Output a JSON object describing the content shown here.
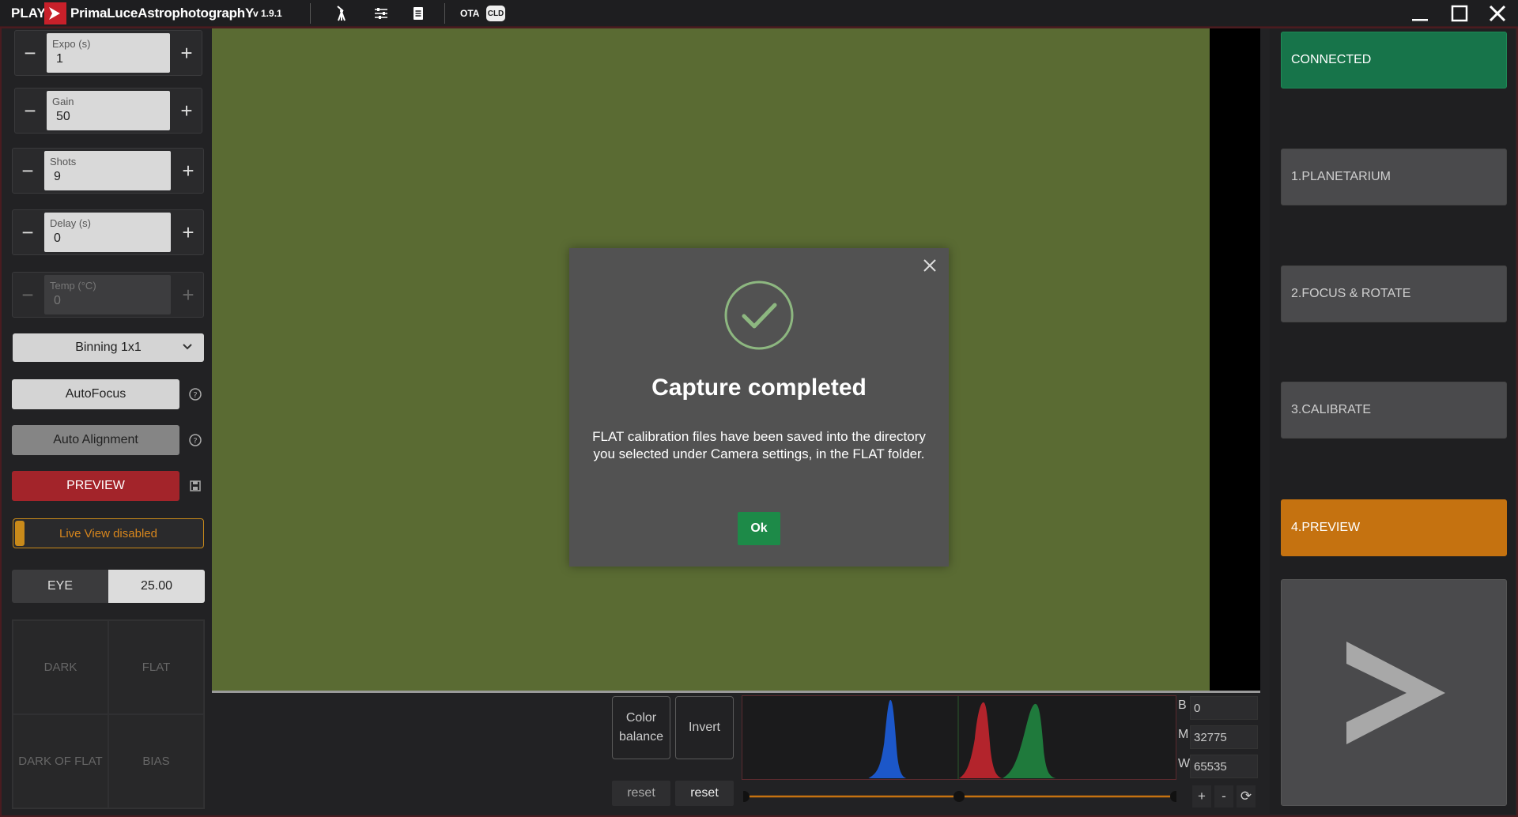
{
  "titlebar": {
    "play": "PLAY",
    "app_name": "PrimaLuceAstrophotographY",
    "version": "v 1.9.1",
    "ota_label": "OTA",
    "cld_label": "CLD"
  },
  "left": {
    "expo": {
      "label": "Expo (s)",
      "value": "1"
    },
    "gain": {
      "label": "Gain",
      "value": "50"
    },
    "shots": {
      "label": "Shots",
      "value": "9"
    },
    "delay": {
      "label": "Delay (s)",
      "value": "0"
    },
    "temp": {
      "label": "Temp (°C)",
      "value": "0"
    },
    "minus": "−",
    "plus": "+",
    "binning": "Binning 1x1",
    "autofocus": "AutoFocus",
    "auto_alignment": "Auto Alignment",
    "preview": "PREVIEW",
    "live_view": "Live View disabled",
    "eye_label": "EYE",
    "eye_value": "25.00",
    "calib": {
      "dark": "DARK",
      "flat": "FLAT",
      "dark_of_flat": "DARK OF FLAT",
      "bias": "BIAS"
    }
  },
  "bottom": {
    "color_balance": "Color\nbalance",
    "invert": "Invert",
    "reset1": "reset",
    "reset2": "reset",
    "b_label": "B",
    "m_label": "M",
    "w_label": "W",
    "b_value": "0",
    "m_value": "32775",
    "w_value": "65535",
    "plus": "+",
    "minus": "-",
    "refresh": "⟳"
  },
  "right": {
    "connected": "CONNECTED",
    "planetarium": "1.PLANETARIUM",
    "focus_rotate": "2.FOCUS & ROTATE",
    "calibrate": "3.CALIBRATE",
    "preview": "4.PREVIEW"
  },
  "modal": {
    "title": "Capture completed",
    "message": "FLAT calibration files have been saved into the directory you selected under Camera settings, in the FLAT folder.",
    "ok": "Ok"
  },
  "colors": {
    "image_bg": "#5a6b33",
    "connected": "#17744a",
    "preview_active": "#c57210",
    "preview_button": "#a3242a",
    "ok_button": "#1d8a48"
  }
}
